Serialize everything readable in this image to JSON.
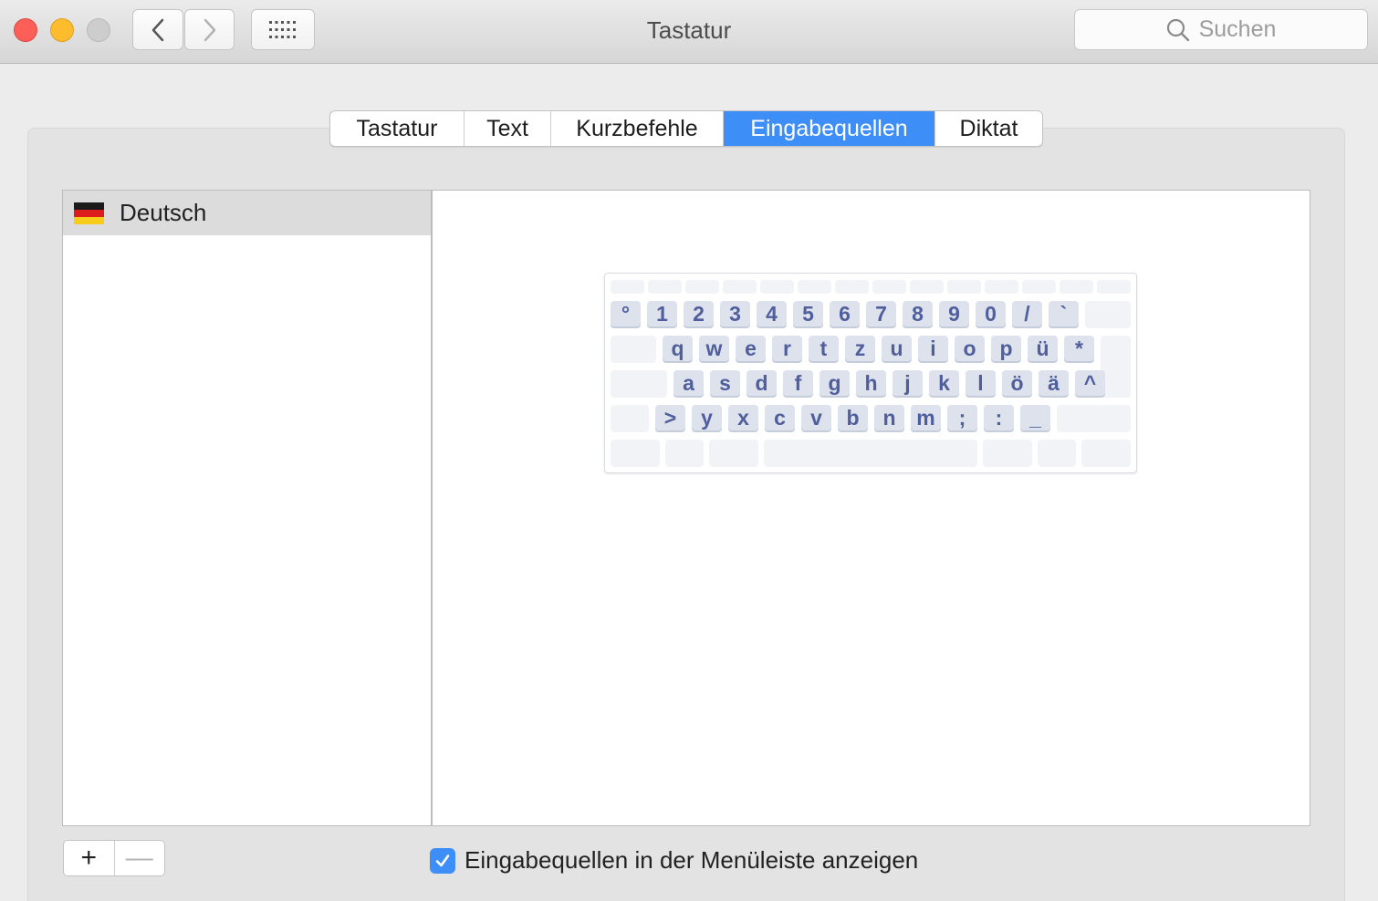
{
  "window": {
    "title": "Tastatur"
  },
  "search": {
    "placeholder": "Suchen",
    "icon": "magnifier-icon"
  },
  "tabs": [
    {
      "label": "Tastatur",
      "active": false
    },
    {
      "label": "Text",
      "active": false
    },
    {
      "label": "Kurzbefehle",
      "active": false
    },
    {
      "label": "Eingabequellen",
      "active": true
    },
    {
      "label": "Diktat",
      "active": false
    }
  ],
  "input_sources": {
    "items": [
      {
        "label": "Deutsch",
        "icon": "german-flag-icon",
        "selected": true
      }
    ]
  },
  "keyboard": {
    "row1": [
      "°",
      "1",
      "2",
      "3",
      "4",
      "5",
      "6",
      "7",
      "8",
      "9",
      "0",
      "/",
      "`"
    ],
    "row2": [
      "q",
      "w",
      "e",
      "r",
      "t",
      "z",
      "u",
      "i",
      "o",
      "p",
      "ü",
      "*"
    ],
    "row3": [
      "a",
      "s",
      "d",
      "f",
      "g",
      "h",
      "j",
      "k",
      "l",
      "ö",
      "ä",
      "^"
    ],
    "row4": [
      ">",
      "y",
      "x",
      "c",
      "v",
      "b",
      "n",
      "m",
      ";",
      ":",
      "_"
    ]
  },
  "buttons": {
    "add": "+",
    "remove": "—"
  },
  "show_in_menubar": {
    "label": "Eingabequellen in der Menüleiste anzeigen",
    "checked": true
  },
  "colors": {
    "accent": "#3d8ef7",
    "key_text": "#4f5e9c"
  }
}
